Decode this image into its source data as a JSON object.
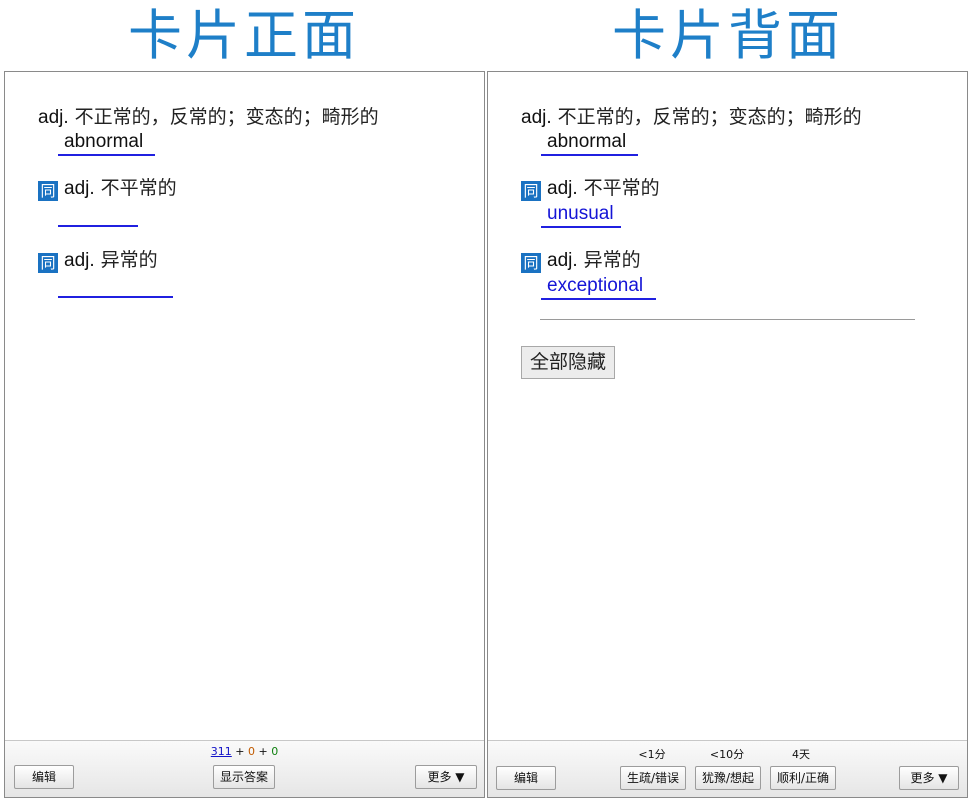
{
  "headings": {
    "front": "卡片正面",
    "back": "卡片背面"
  },
  "card": {
    "definition_pos": "adj.",
    "definition_text": " 不正常的，反常的；变态的；畸形的",
    "word": "abnormal",
    "synonym_icon": "同",
    "synonyms": [
      {
        "pos": "adj.",
        "meaning": " 不平常的",
        "word": "unusual"
      },
      {
        "pos": "adj.",
        "meaning": " 异常的",
        "word": "exceptional"
      }
    ]
  },
  "front_footer": {
    "edit_label": "编辑",
    "show_answer_label": "显示答案",
    "more_label": "更多 ▼",
    "counts": {
      "new": "311",
      "learning": "0",
      "review": "0",
      "sep": "+"
    }
  },
  "back_content": {
    "hide_all_label": "全部隐藏"
  },
  "back_footer": {
    "edit_label": "编辑",
    "more_label": "更多 ▼",
    "answers": [
      {
        "interval": "<1分",
        "label": "生疏/错误"
      },
      {
        "interval": "<10分",
        "label": "犹豫/想起"
      },
      {
        "interval": "4天",
        "label": "顺利/正确"
      }
    ]
  }
}
